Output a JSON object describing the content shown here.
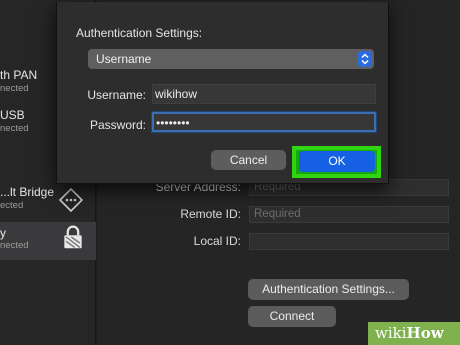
{
  "sidebar": {
    "items": [
      {
        "name": "th PAN",
        "status": "nected"
      },
      {
        "name": "USB",
        "status": "nected"
      },
      {
        "name": "...lt Bridge",
        "status": "ected"
      },
      {
        "name": "y",
        "status": "nected"
      }
    ]
  },
  "background_form": {
    "server_address_label": "Server Address:",
    "server_address_placeholder": "Required",
    "remote_id_label": "Remote ID:",
    "remote_id_placeholder": "Required",
    "local_id_label": "Local ID:",
    "local_id_value": "",
    "auth_settings_button": "Authentication Settings...",
    "connect_button": "Connect"
  },
  "dialog": {
    "title": "Authentication Settings:",
    "auth_type_selected": "Username",
    "username_label": "Username:",
    "username_value": "wikihow",
    "password_label": "Password:",
    "password_value": "••••••••",
    "cancel_label": "Cancel",
    "ok_label": "OK"
  },
  "watermark": {
    "prefix": "wiki",
    "suffix": "How"
  },
  "colors": {
    "ok_button": "#1661e3",
    "highlight": "#30d40f",
    "select_arrows": "#2c6bdf",
    "focus_ring": "#3b6fb0"
  }
}
